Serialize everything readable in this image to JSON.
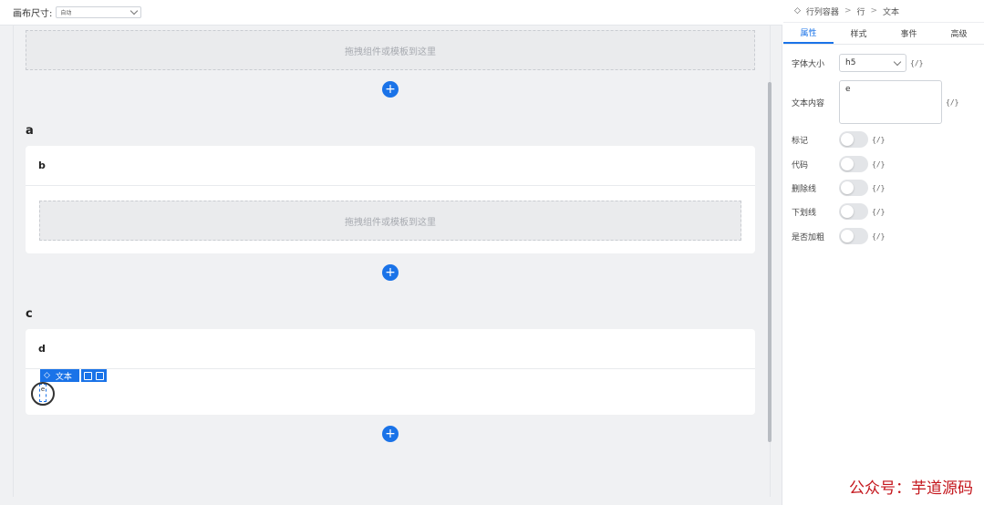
{
  "toolbar": {
    "canvas_size_label": "画布尺寸:",
    "canvas_size_value": "自动"
  },
  "canvas": {
    "top_drop_text": "拖拽组件或模板到这里",
    "section_a": "a",
    "card_b_title": "b",
    "card_b_drop_text": "拖拽组件或模板到这里",
    "section_c": "c",
    "card_d_title": "d",
    "plus": "+",
    "selected_tag_label": "文本",
    "selected_text": "e"
  },
  "panel": {
    "breadcrumb": [
      "行列容器",
      "行",
      "文本"
    ],
    "breadcrumb_sep": ">",
    "tabs": [
      "属性",
      "样式",
      "事件",
      "高级"
    ],
    "font_size_label": "字体大小",
    "font_size_value": "h5",
    "expr_badge": "{/}",
    "content_label": "文本内容",
    "content_value": "e",
    "toggles": [
      {
        "label": "标记",
        "on": false
      },
      {
        "label": "代码",
        "on": false
      },
      {
        "label": "删除线",
        "on": false
      },
      {
        "label": "下划线",
        "on": false
      },
      {
        "label": "是否加粗",
        "on": false
      }
    ]
  },
  "watermark": "公众号：芋道源码",
  "colors": {
    "accent": "#1a73e8",
    "watermark": "#c4161c"
  }
}
